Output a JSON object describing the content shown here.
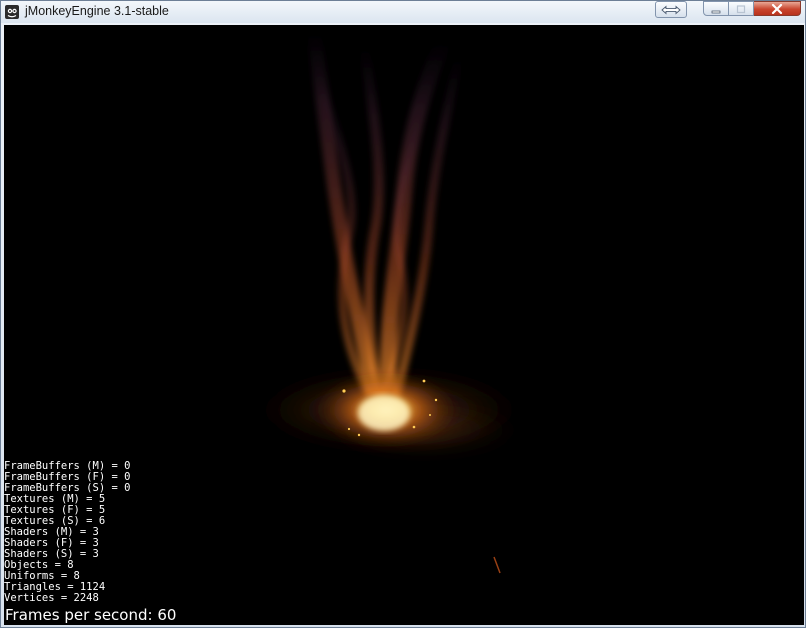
{
  "window": {
    "title": "jMonkeyEngine 3.1-stable",
    "icon": "jmonkeyengine-logo-icon"
  },
  "caption_buttons": {
    "resize": "resize-arrows-icon",
    "minimize": "minimize-icon",
    "maximize": "maximize-icon",
    "close": "close-icon"
  },
  "stats": [
    "FrameBuffers (M) = 0",
    "FrameBuffers (F) = 0",
    "FrameBuffers (S) = 0",
    "Textures (M) = 5",
    "Textures (F) = 5",
    "Textures (S) = 6",
    "Shaders (M) = 3",
    "Shaders (F) = 3",
    "Shaders (S) = 3",
    "Objects = 8",
    "Uniforms = 8",
    "Triangles = 1124",
    "Vertices = 2248"
  ],
  "fps_text": "Frames per second: 60",
  "colors": {
    "viewport_background": "#000000",
    "fire_core": "#ffd24a",
    "fire_mid": "#f07a1a",
    "smoke": "#8a4a6a"
  }
}
